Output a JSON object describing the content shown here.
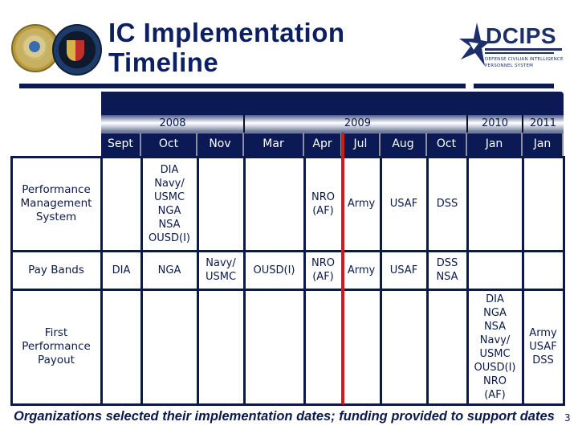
{
  "slide": {
    "title_line1": "IC Implementation",
    "title_line2": "Timeline",
    "logos": {
      "left_seal_1": "Department of the Army seal",
      "left_seal_2": "Intelligence seal",
      "right_logo_word": "DCIPS",
      "right_logo_sub1": "DEFENSE CIVILIAN INTELLIGENCE",
      "right_logo_sub2": "PERSONNEL SYSTEM"
    },
    "footer": "Organizations selected their implementation dates; funding provided to support dates",
    "page_number": "3"
  },
  "timeline": {
    "years": [
      {
        "label": "2008",
        "span": 3
      },
      {
        "label": "2009",
        "span": 6
      },
      {
        "label": "2010",
        "span": 1
      },
      {
        "label": "2011",
        "span": 1
      }
    ],
    "months": [
      "Sept",
      "Oct",
      "Nov",
      "Mar",
      "Apr",
      "Jul",
      "Aug",
      "Oct",
      "Jan",
      "Jan"
    ],
    "current_marker": "between Apr and Jul 2009",
    "marker_color": "#d11a1a",
    "rows": [
      {
        "label": "Performance Management System",
        "label_lines": [
          "Performance",
          "Management",
          "System"
        ],
        "cells": [
          [],
          [
            "DIA",
            "Navy/",
            "USMC",
            "NGA",
            "NSA",
            "OUSD(I)"
          ],
          [],
          [],
          [
            "NRO",
            "(AF)"
          ],
          [
            "Army"
          ],
          [
            "USAF"
          ],
          [
            "DSS"
          ],
          [],
          []
        ]
      },
      {
        "label": "Pay Bands",
        "label_lines": [
          "Pay Bands"
        ],
        "cells": [
          [
            "DIA"
          ],
          [
            "NGA"
          ],
          [
            "Navy/",
            "USMC"
          ],
          [
            "OUSD(I)"
          ],
          [
            "NRO",
            "(AF)"
          ],
          [
            "Army"
          ],
          [
            "USAF"
          ],
          [
            "DSS",
            "NSA"
          ],
          [],
          []
        ]
      },
      {
        "label": "First Performance Payout",
        "label_lines": [
          "First",
          "Performance",
          "Payout"
        ],
        "cells": [
          [],
          [],
          [],
          [],
          [],
          [],
          [],
          [],
          [
            "DIA",
            "NGA",
            "NSA",
            "Navy/",
            "USMC",
            "OUSD(I)",
            "NRO",
            "(AF)"
          ],
          [
            "Army",
            "USAF",
            "DSS"
          ]
        ]
      }
    ]
  },
  "colors": {
    "navy": "#0b1a4a",
    "header_navy": "#0b1a55",
    "title_blue": "#0d1f63",
    "red_marker": "#d11a1a"
  }
}
